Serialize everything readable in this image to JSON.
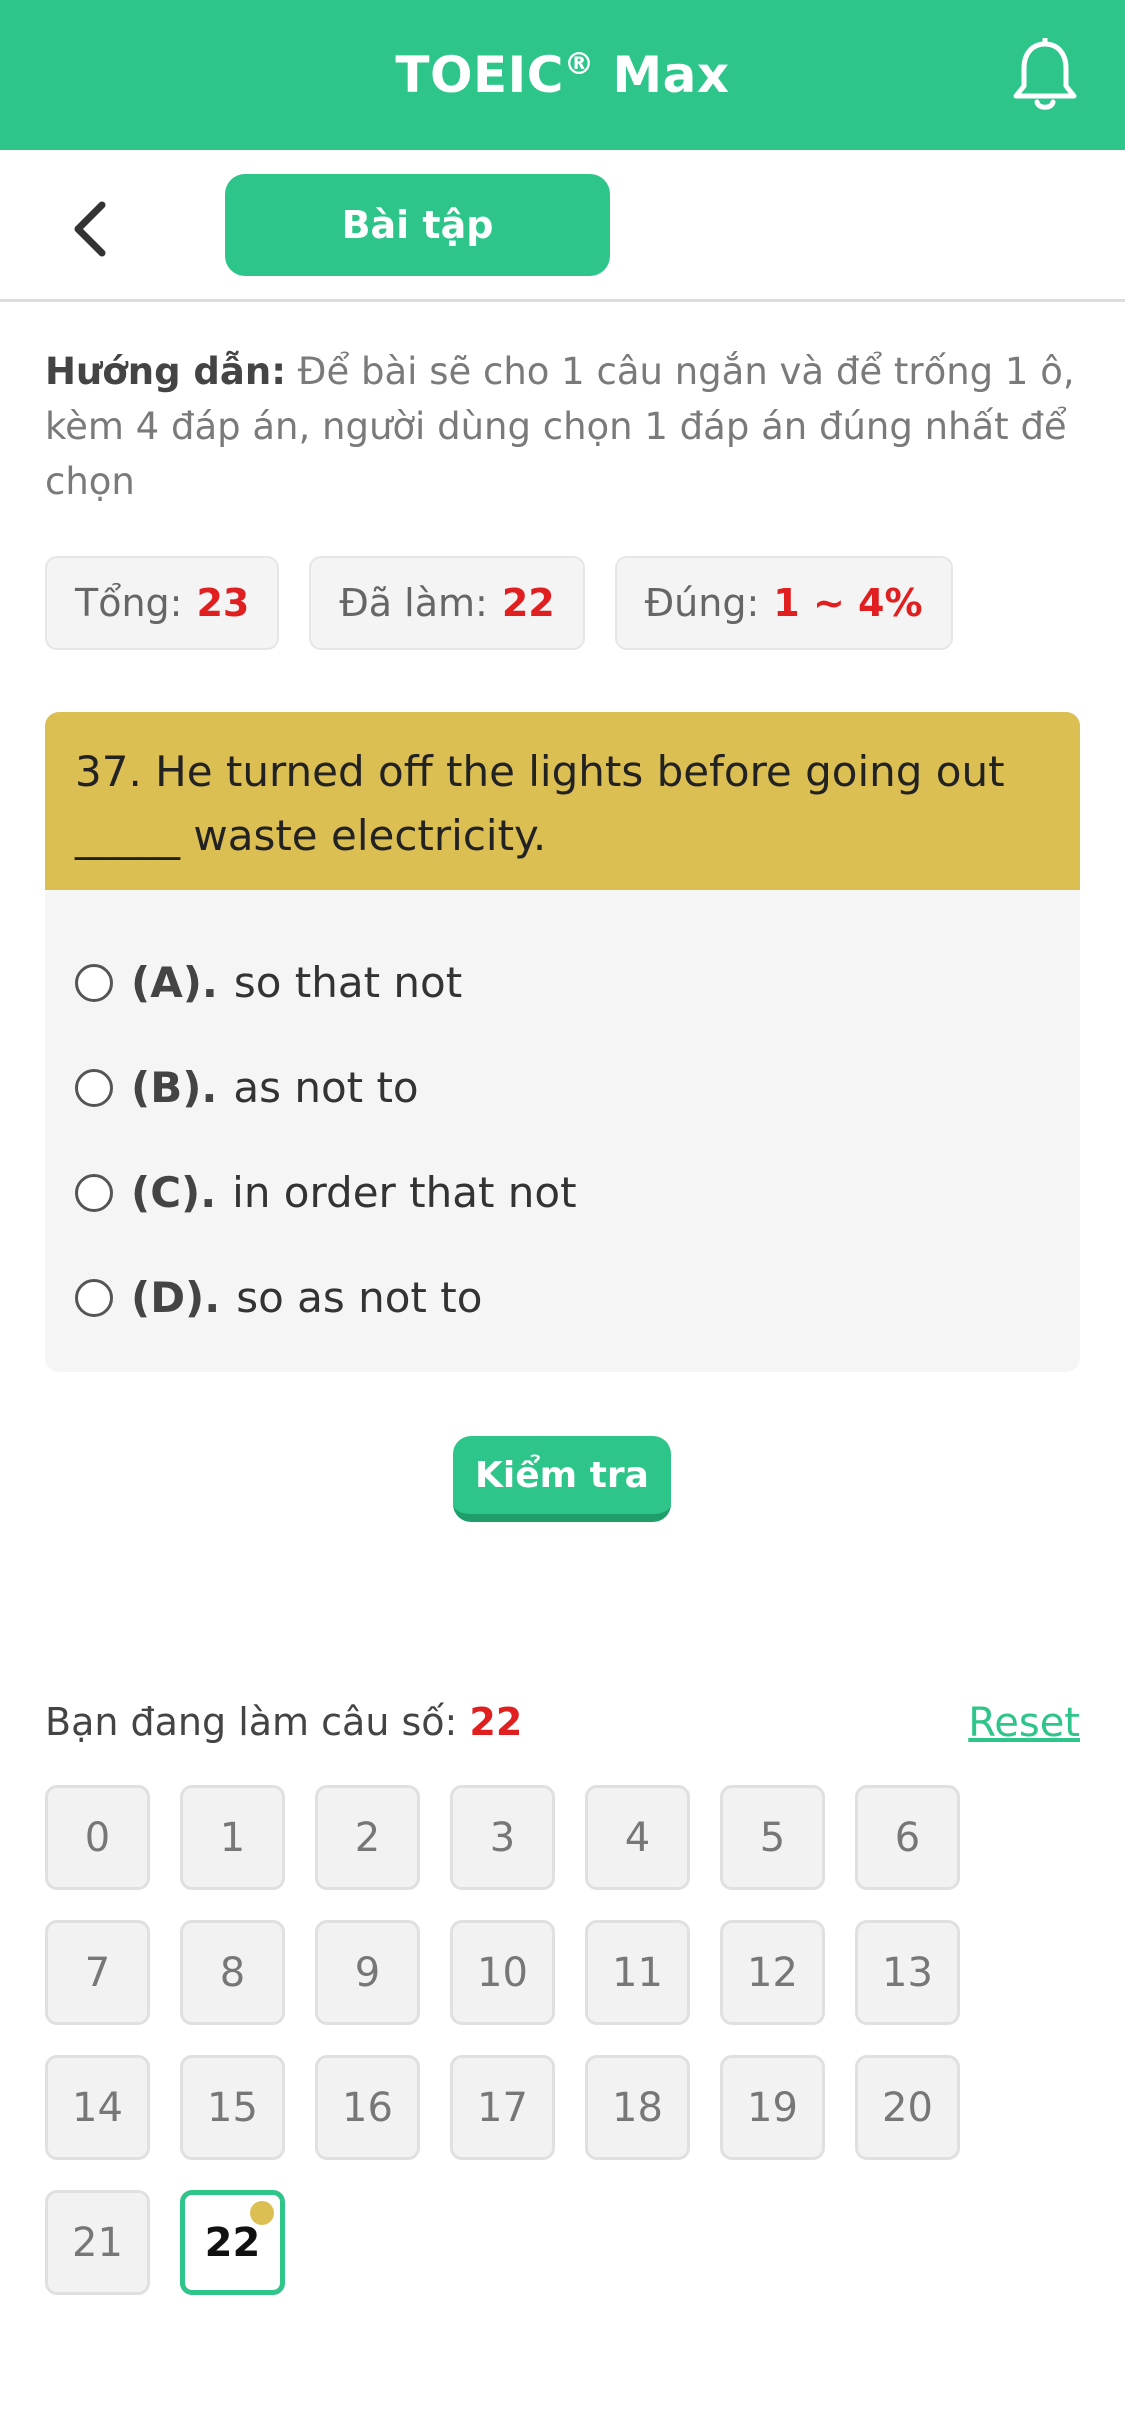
{
  "header": {
    "title": "TOEIC",
    "reg": "®",
    "title_suffix": " Max"
  },
  "toolbar": {
    "tab_label": "Bài tập"
  },
  "instructions": {
    "label": "Hướng dẫn:",
    "text": " Để bài sẽ cho 1 câu ngắn và để trống 1 ô, kèm 4 đáp án, người dùng chọn 1 đáp án đúng nhất để chọn"
  },
  "stats": [
    {
      "label": "Tổng:",
      "value": "23"
    },
    {
      "label": "Đã làm:",
      "value": "22"
    },
    {
      "label": "Đúng:",
      "value": "1 ~ 4%"
    }
  ],
  "question": {
    "text": "37. He turned off the lights before going out _____ waste electricity.",
    "options": [
      {
        "letter": "(A).",
        "text": "so that not"
      },
      {
        "letter": "(B).",
        "text": "as not to"
      },
      {
        "letter": "(C).",
        "text": "in order that not"
      },
      {
        "letter": "(D).",
        "text": "so as not to"
      }
    ]
  },
  "check_button": "Kiểm tra",
  "progress": {
    "label": "Bạn đang làm câu số: ",
    "current": "22"
  },
  "reset_label": "Reset",
  "question_numbers": [
    "0",
    "1",
    "2",
    "3",
    "4",
    "5",
    "6",
    "7",
    "8",
    "9",
    "10",
    "11",
    "12",
    "13",
    "14",
    "15",
    "16",
    "17",
    "18",
    "19",
    "20",
    "21",
    "22"
  ],
  "colors": {
    "accent": "#2dc58a",
    "question_bg": "#dcbf52",
    "highlight": "#e02020"
  },
  "icons": {
    "bell": "bell-icon",
    "back": "chevron-left-icon"
  }
}
